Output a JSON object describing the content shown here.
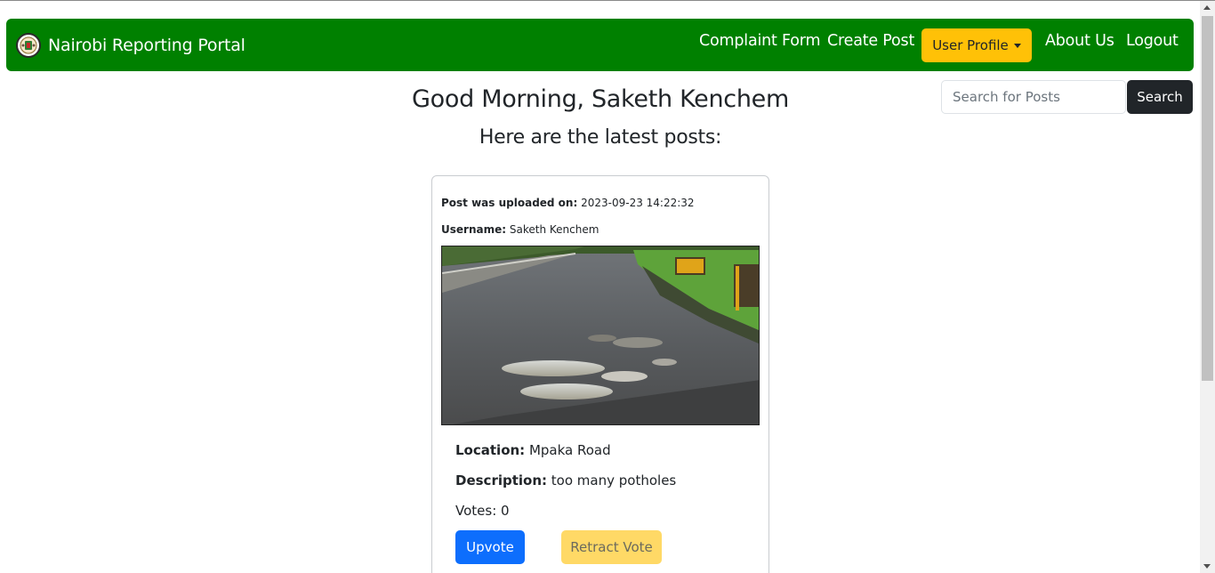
{
  "navbar": {
    "brand": "Nairobi Reporting Portal",
    "links": {
      "complaint_form": "Complaint Form",
      "create_post": "Create Post",
      "about_us": "About Us",
      "logout": "Logout"
    },
    "profile_button": "User Profile",
    "background_color": "#008000"
  },
  "search": {
    "placeholder": "Search for Posts",
    "button": "Search"
  },
  "main": {
    "greeting": "Good Morning, Saketh Kenchem",
    "subheading": "Here are the latest posts:"
  },
  "post": {
    "uploaded_label": "Post was uploaded on:",
    "uploaded_value": "2023-09-23 14:22:32",
    "username_label": "Username:",
    "username_value": "Saketh Kenchem",
    "location_label": "Location:",
    "location_value": "Mpaka Road",
    "description_label": "Description:",
    "description_value": "too many potholes",
    "votes_text": "Votes: 0",
    "upvote_button": "Upvote",
    "retract_button": "Retract Vote"
  }
}
